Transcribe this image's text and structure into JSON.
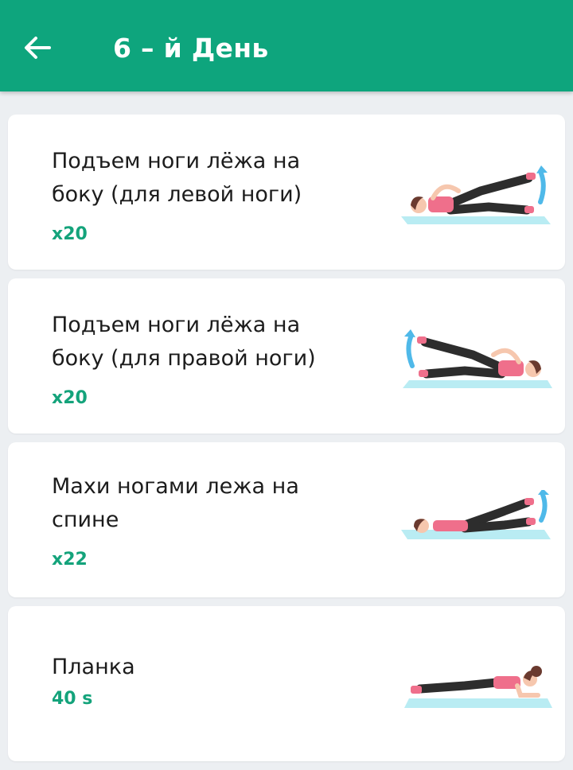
{
  "header": {
    "title": "6 – й День",
    "back_icon": "arrow-left-icon",
    "color": "#0ea57d"
  },
  "exercises": [
    {
      "name_line1": "Подъем ноги лёжа на",
      "name_line2": "боку (для левой ноги)",
      "amount": "x20",
      "illustration": "side-leg-raise-left-illustration"
    },
    {
      "name_line1": "Подъем ноги лёжа на",
      "name_line2": "боку (для правой ноги)",
      "amount": "x20",
      "illustration": "side-leg-raise-right-illustration"
    },
    {
      "name_line1": "Махи ногами лежа на",
      "name_line2": "спине",
      "amount": "x22",
      "illustration": "lying-leg-swings-illustration"
    },
    {
      "name_line1": "Планка",
      "name_line2": "",
      "amount": "40 s",
      "illustration": "plank-illustration"
    }
  ],
  "colors": {
    "accent": "#14a37b",
    "mat": "#b9ecf3",
    "top": "#ef6f8b",
    "legs": "#2d2d2d",
    "skin": "#f6c7ae",
    "hair": "#6a3a2f",
    "arrow": "#4fb9e9"
  }
}
